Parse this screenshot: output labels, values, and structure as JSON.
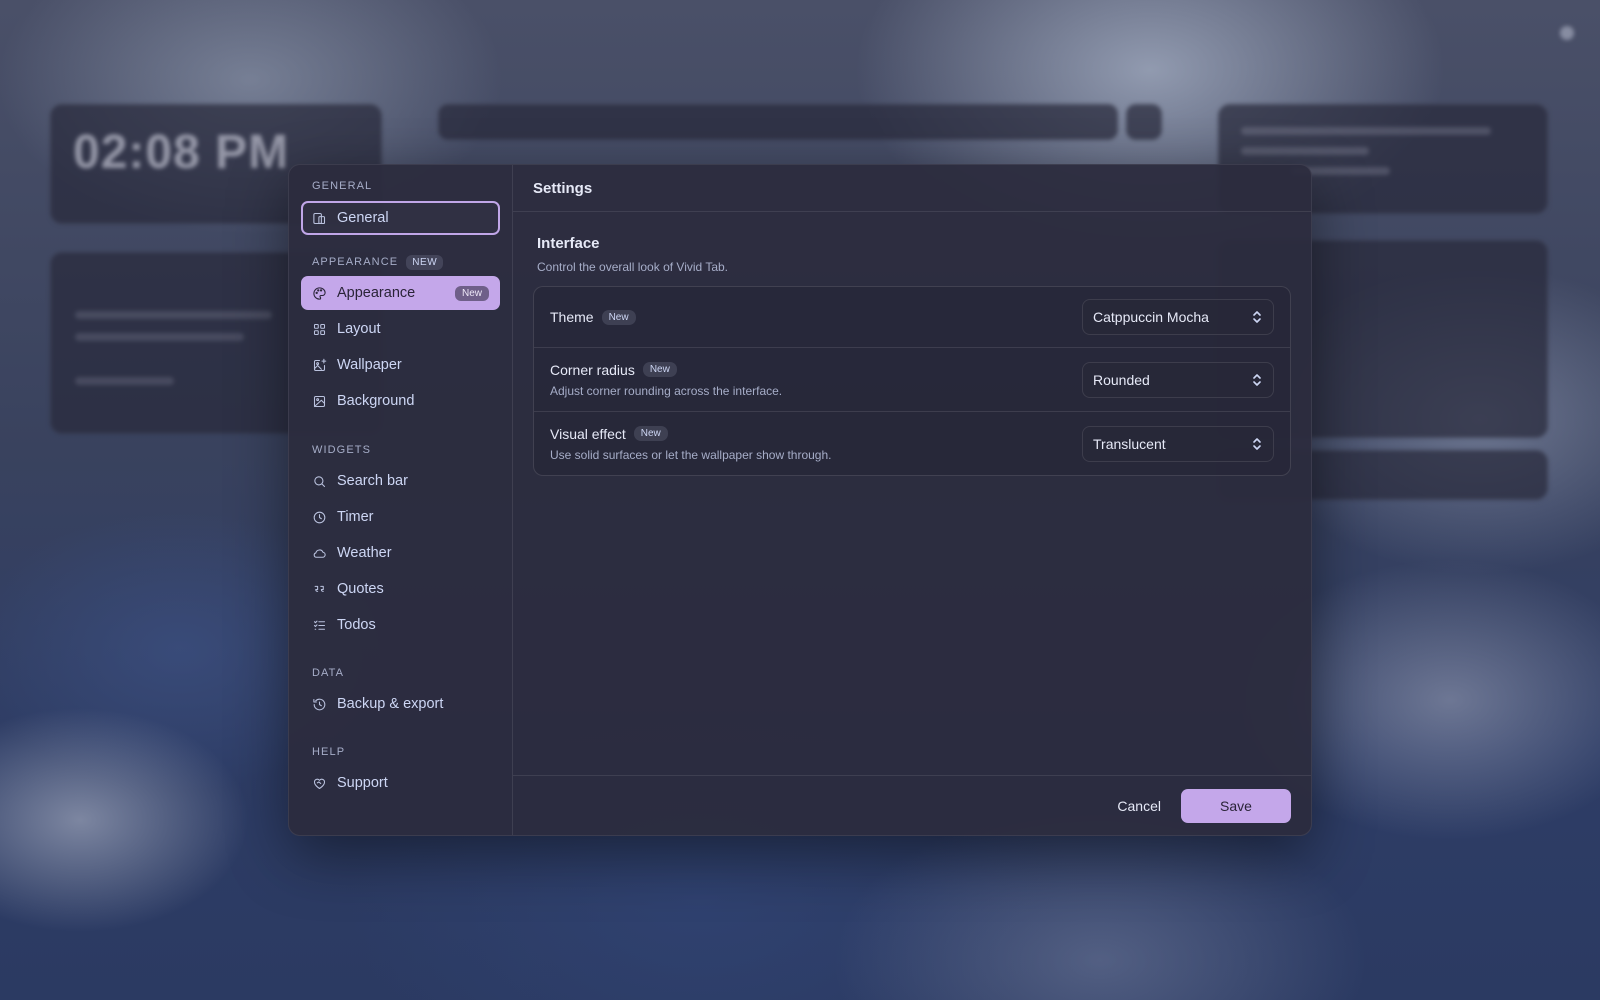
{
  "background": {
    "clock_time": "02:08 PM"
  },
  "sidebar": {
    "sections": [
      {
        "title": "GENERAL"
      },
      {
        "title": "APPEARANCE",
        "tag": "NEW"
      },
      {
        "title": "WIDGETS"
      },
      {
        "title": "DATA"
      },
      {
        "title": "HELP"
      }
    ],
    "items": [
      {
        "label": "General",
        "icon": "devices-icon",
        "state": "focused"
      },
      {
        "label": "Appearance",
        "icon": "palette-icon",
        "state": "active",
        "badge": "New"
      },
      {
        "label": "Layout",
        "icon": "grid-icon"
      },
      {
        "label": "Wallpaper",
        "icon": "image-plus-icon"
      },
      {
        "label": "Background",
        "icon": "image-icon"
      },
      {
        "label": "Search bar",
        "icon": "search-icon"
      },
      {
        "label": "Timer",
        "icon": "clock-icon"
      },
      {
        "label": "Weather",
        "icon": "cloud-icon"
      },
      {
        "label": "Quotes",
        "icon": "quote-icon"
      },
      {
        "label": "Todos",
        "icon": "list-todo-icon"
      },
      {
        "label": "Backup & export",
        "icon": "history-icon"
      },
      {
        "label": "Support",
        "icon": "heart-handshake-icon"
      }
    ]
  },
  "main": {
    "title": "Settings",
    "group": {
      "title": "Interface",
      "description": "Control the overall look of Vivid Tab."
    },
    "rows": [
      {
        "label": "Theme",
        "badge": "New",
        "value": "Catppuccin Mocha"
      },
      {
        "label": "Corner radius",
        "badge": "New",
        "description": "Adjust corner rounding across the interface.",
        "value": "Rounded"
      },
      {
        "label": "Visual effect",
        "badge": "New",
        "description": "Use solid surfaces or let the wallpaper show through.",
        "value": "Translucent"
      }
    ]
  },
  "footer": {
    "cancel_label": "Cancel",
    "save_label": "Save"
  },
  "colors": {
    "accent": "#c4a7ea",
    "panel": "#2c2c3e",
    "text": "#cdd6f4",
    "muted": "#a6adc8"
  }
}
